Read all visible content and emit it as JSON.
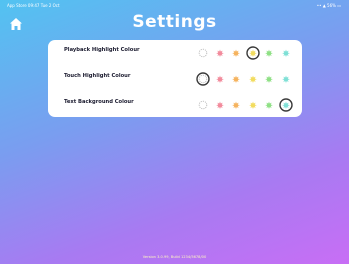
{
  "status_bar": {
    "left": "App Store 09:47 Tue 2 Oct",
    "right": "•• ▲ 56% ▭"
  },
  "header": {
    "title": "Settings",
    "home_icon": "home-icon"
  },
  "settings": [
    {
      "label": "Playback Highlight Colour",
      "selected_index": 3,
      "swatches": [
        {
          "icon": "dashed-circle",
          "color": "#b8b8b8"
        },
        {
          "icon": "star",
          "color": "#f28b9c"
        },
        {
          "icon": "star",
          "color": "#f5b35e"
        },
        {
          "icon": "star",
          "color": "#f2dc5e"
        },
        {
          "icon": "star",
          "color": "#8fe085"
        },
        {
          "icon": "star",
          "color": "#7fe0d6"
        }
      ]
    },
    {
      "label": "Touch Highlight Colour",
      "selected_index": 0,
      "swatches": [
        {
          "icon": "dashed-circle",
          "color": "#b8b8b8"
        },
        {
          "icon": "star",
          "color": "#f28b9c"
        },
        {
          "icon": "star",
          "color": "#f5b35e"
        },
        {
          "icon": "star",
          "color": "#f2dc5e"
        },
        {
          "icon": "star",
          "color": "#8fe085"
        },
        {
          "icon": "star",
          "color": "#7fe0d6"
        }
      ]
    },
    {
      "label": "Text Background Colour",
      "selected_index": 5,
      "swatches": [
        {
          "icon": "dashed-circle",
          "color": "#b8b8b8"
        },
        {
          "icon": "star",
          "color": "#f28b9c"
        },
        {
          "icon": "star",
          "color": "#f5b35e"
        },
        {
          "icon": "star",
          "color": "#f2dc5e"
        },
        {
          "icon": "star",
          "color": "#8fe085"
        },
        {
          "icon": "star",
          "color": "#7fe0d6"
        }
      ]
    }
  ],
  "footer": {
    "version": "Version 3.0.99, Build 1234/5678/00"
  }
}
